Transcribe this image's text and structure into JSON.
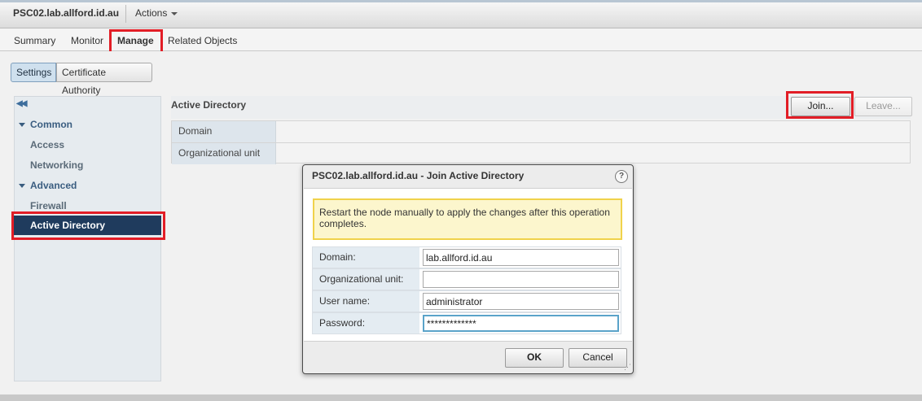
{
  "header": {
    "object_title": "PSC02.lab.allford.id.au",
    "actions_label": "Actions"
  },
  "tabs": [
    {
      "label": "Summary"
    },
    {
      "label": "Monitor"
    },
    {
      "label": "Manage",
      "active": true
    },
    {
      "label": "Related Objects"
    }
  ],
  "settings_toggle": {
    "settings": "Settings",
    "certificate_authority": "Certificate Authority"
  },
  "nav": {
    "common_label": "Common",
    "access": "Access",
    "networking": "Networking",
    "advanced_label": "Advanced",
    "firewall": "Firewall",
    "active_directory": "Active Directory"
  },
  "panel": {
    "title": "Active Directory",
    "join_button": "Join...",
    "leave_button": "Leave...",
    "rows": [
      {
        "key": "Domain",
        "value": ""
      },
      {
        "key": "Organizational unit",
        "value": ""
      }
    ]
  },
  "dialog": {
    "title": "PSC02.lab.allford.id.au - Join Active Directory",
    "help": "?",
    "warning": "Restart the node manually to apply the changes after this operation completes.",
    "fields": {
      "domain": {
        "label": "Domain:",
        "value": "lab.allford.id.au"
      },
      "ou": {
        "label": "Organizational unit:",
        "value": ""
      },
      "username": {
        "label": "User name:",
        "value": "administrator"
      },
      "password": {
        "label": "Password:",
        "value": "*************"
      }
    },
    "ok": "OK",
    "cancel": "Cancel"
  },
  "colors": {
    "highlight": "#e21d26",
    "nav_selected": "#1f3b5d",
    "warning_bg": "#fcf6cd",
    "warning_border": "#f0d24b"
  }
}
